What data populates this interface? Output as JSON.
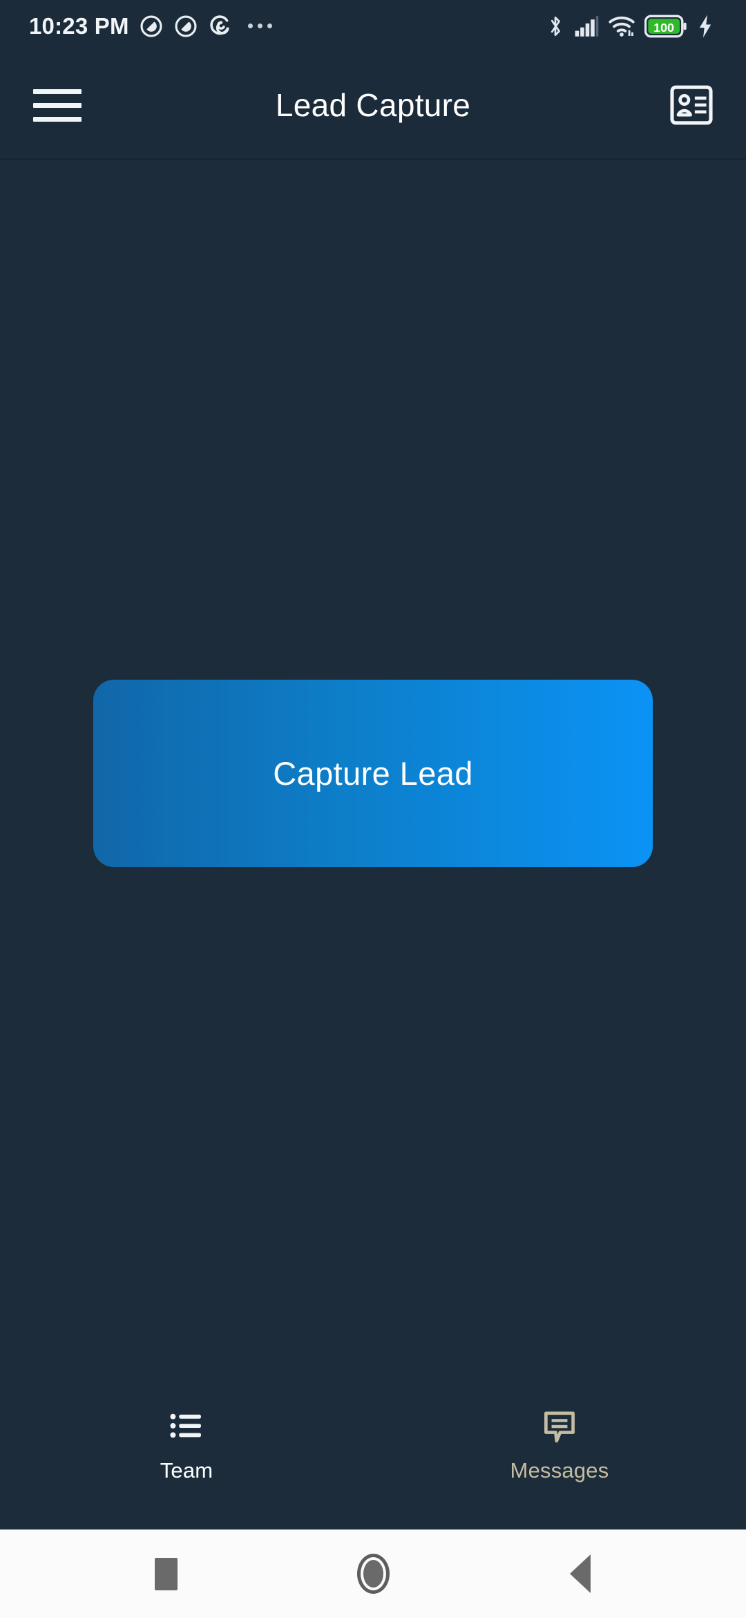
{
  "status_bar": {
    "time": "10:23 PM",
    "left_icons": [
      "notification-circle-icon",
      "notification-circle-icon",
      "spiral-app-icon",
      "overflow-dots-icon"
    ],
    "right_icons": [
      "bluetooth-icon",
      "cellular-signal-icon",
      "wifi-icon",
      "battery-icon",
      "charging-bolt-icon"
    ],
    "battery_level": "100",
    "battery_color": "#2fbb28"
  },
  "app_bar": {
    "menu_icon": "hamburger-menu-icon",
    "title": "Lead Capture",
    "action_icon": "contact-badge-icon"
  },
  "main": {
    "primary_button": {
      "label": "Capture Lead",
      "gradient_start": "#1167a8",
      "gradient_end": "#0b93f5",
      "text_color": "#ffffff"
    }
  },
  "bottom_nav": {
    "items": [
      {
        "label": "Team",
        "icon": "list-icon",
        "active": true,
        "color": "#ffffff"
      },
      {
        "label": "Messages",
        "icon": "message-bubble-icon",
        "active": false,
        "color": "#c5bda2"
      }
    ]
  },
  "android_nav": {
    "buttons": [
      "recents-square-icon",
      "home-circle-icon",
      "back-triangle-icon"
    ]
  },
  "theme": {
    "background": "#1d2c3b",
    "bar_background": "#1c2b3a",
    "accent": "#0b93f5"
  }
}
